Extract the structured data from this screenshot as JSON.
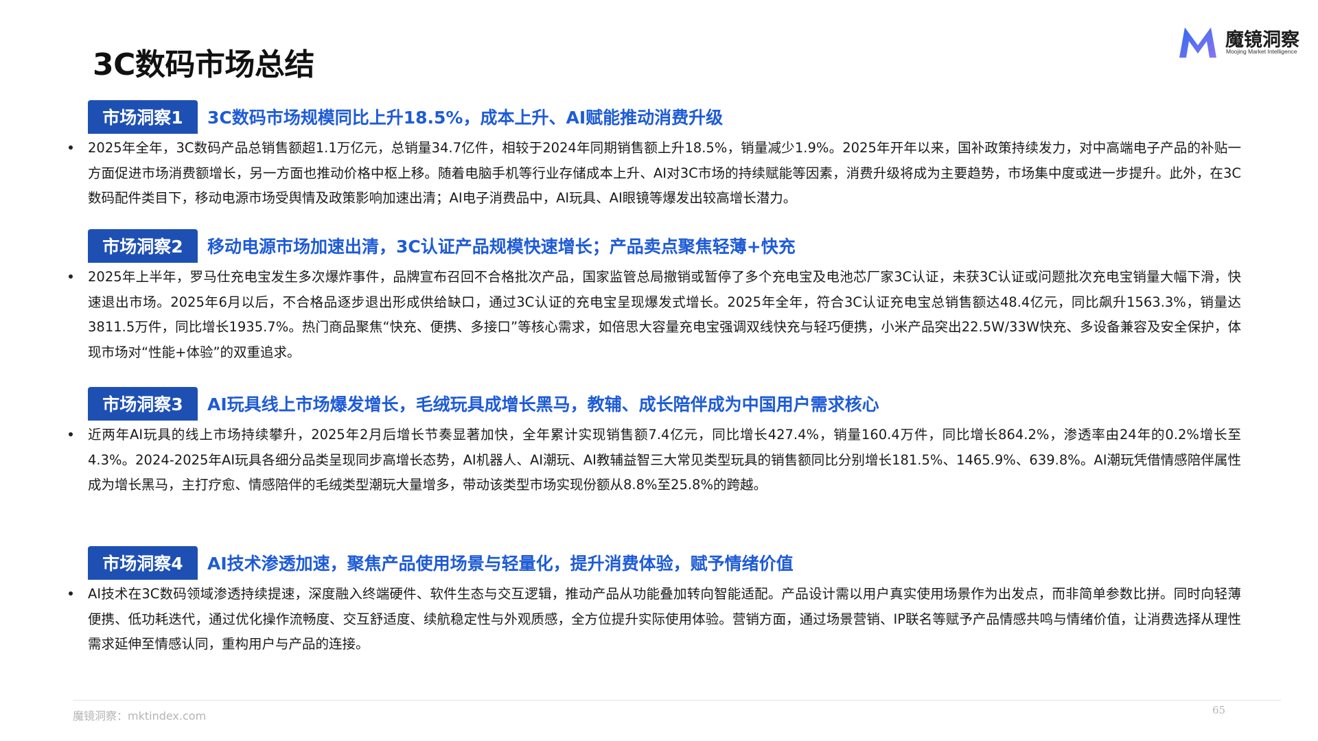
{
  "page": {
    "title": "3C数码市场总结",
    "page_number": "65"
  },
  "logo": {
    "name": "魔镜洞察",
    "subtitle": "Moojing Market Intelligence",
    "mark_colors": [
      "#2f6bf0",
      "#8a74f3"
    ]
  },
  "sections": [
    {
      "tag": "市场洞察1",
      "headline": "3C数码市场规模同比上升18.5%，成本上升、AI赋能推动消费升级",
      "text": "2025年全年，3C数码产品总销售额超1.1万亿元，总销量34.7亿件，相较于2024年同期销售额上升18.5%，销量减少1.9%。2025年开年以来，国补政策持续发力，对中高端电子产品的补贴一方面促进市场消费额增长，另一方面也推动价格中枢上移。随着电脑手机等行业存储成本上升、AI对3C市场的持续赋能等因素，消费升级将成为主要趋势，市场集中度或进一步提升。此外，在3C数码配件类目下，移动电源市场受舆情及政策影响加速出清；AI电子消费品中，AI玩具、AI眼镜等爆发出较高增长潜力。"
    },
    {
      "tag": "市场洞察2",
      "headline": "移动电源市场加速出清，3C认证产品规模快速增长；产品卖点聚焦轻薄+快充",
      "text": "2025年上半年，罗马仕充电宝发生多次爆炸事件，品牌宣布召回不合格批次产品，国家监管总局撤销或暂停了多个充电宝及电池芯厂家3C认证，未获3C认证或问题批次充电宝销量大幅下滑，快速退出市场。2025年6月以后，不合格品逐步退出形成供给缺口，通过3C认证的充电宝呈现爆发式增长。2025年全年，符合3C认证充电宝总销售额达48.4亿元，同比飙升1563.3%，销量达3811.5万件，同比增长1935.7%。热门商品聚焦“快充、便携、多接口”等核心需求，如倍思大容量充电宝强调双线快充与轻巧便携，小米产品突出22.5W/33W快充、多设备兼容及安全保护，体现市场对“性能+体验”的双重追求。"
    },
    {
      "tag": "市场洞察3",
      "headline": "AI玩具线上市场爆发增长，毛绒玩具成增长黑马，教辅、成长陪伴成为中国用户需求核心",
      "text": "近两年AI玩具的线上市场持续攀升，2025年2月后增长节奏显著加快，全年累计实现销售额7.4亿元，同比增长427.4%，销量160.4万件，同比增长864.2%，渗透率由24年的0.2%增长至4.3%。2024-2025年AI玩具各细分品类呈现同步高增长态势，AI机器人、AI潮玩、AI教辅益智三大常见类型玩具的销售额同比分别增长181.5%、1465.9%、639.8%。AI潮玩凭借情感陪伴属性成为增长黑马，主打疗愈、情感陪伴的毛绒类型潮玩大量增多，带动该类型市场实现份额从8.8%至25.8%的跨越。"
    },
    {
      "tag": "市场洞察4",
      "headline": "AI技术渗透加速，聚焦产品使用场景与轻量化，提升消费体验，赋予情绪价值",
      "text": "AI技术在3C数码领域渗透持续提速，深度融入终端硬件、软件生态与交互逻辑，推动产品从功能叠加转向智能适配。产品设计需以用户真实使用场景作为出发点，而非简单参数比拼。同时向轻薄便携、低功耗迭代，通过优化操作流畅度、交互舒适度、续航稳定性与外观质感，全方位提升实际使用体验。营销方面，通过场景营销、IP联名等赋予产品情感共鸣与情绪价值，让消费选择从理性需求延伸至情感认同，重构用户与产品的连接。"
    }
  ],
  "footer": {
    "source": "魔镜洞察：mktindex.com"
  },
  "colors": {
    "tag_bg": "#1e50b4",
    "headline": "#1e5bd6",
    "body_text": "#1a1a1a"
  }
}
